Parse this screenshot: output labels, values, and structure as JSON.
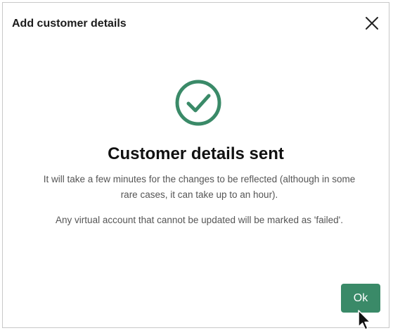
{
  "dialog": {
    "title": "Add customer details",
    "close_icon": "close-icon",
    "success_icon": "check-circle-icon",
    "heading": "Customer details sent",
    "message_1": "It will take a few minutes for the changes to be reflected (although in some rare cases, it can take up to an hour).",
    "message_2": "Any virtual account that cannot be updated will be marked as 'failed'.",
    "ok_label": "Ok"
  },
  "colors": {
    "accent": "#3a8a68",
    "heading": "#111111",
    "body_text": "#555555"
  },
  "pointer_icon": "mouse-pointer-icon"
}
